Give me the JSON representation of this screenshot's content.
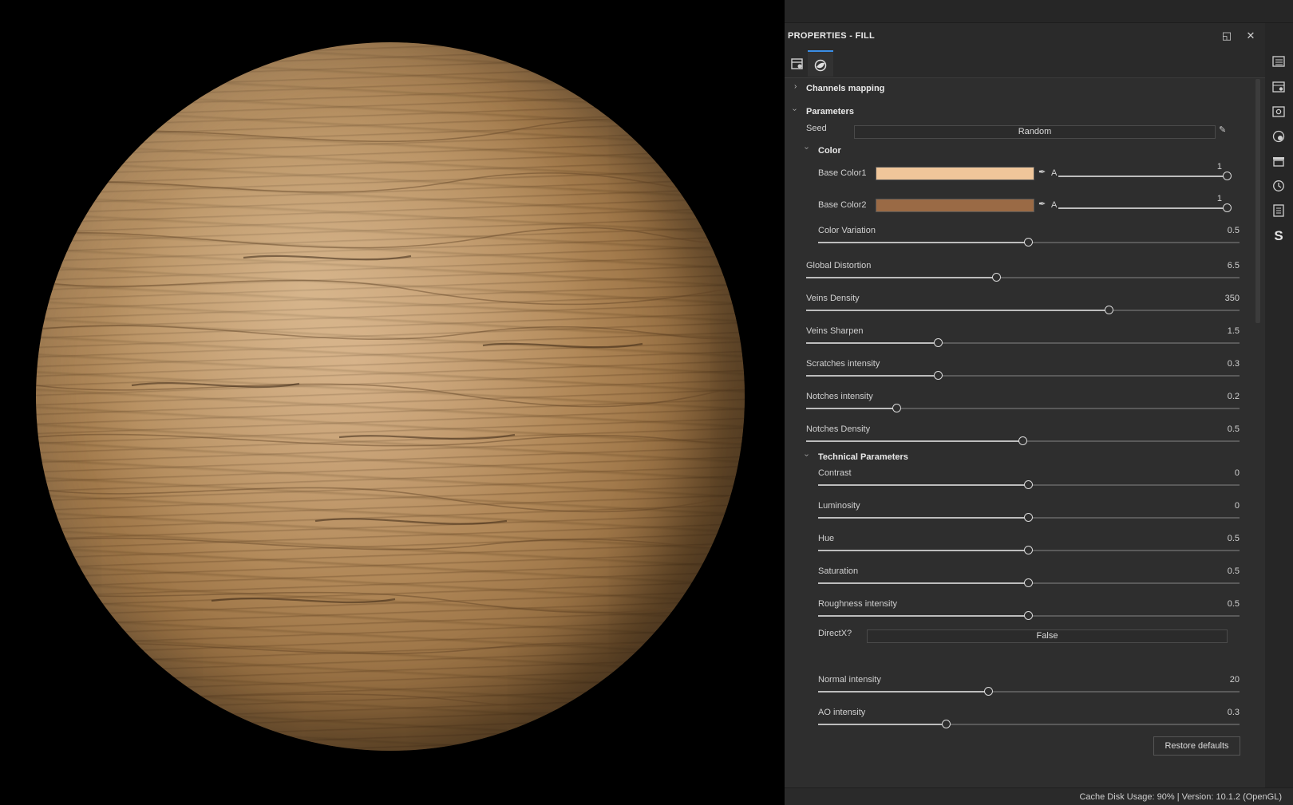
{
  "panel": {
    "title": "PROPERTIES - FILL",
    "restore_label": "◱",
    "close_label": "✕"
  },
  "tabs": [
    {
      "icon": "layer-settings-icon",
      "active": false
    },
    {
      "icon": "material-sphere-icon",
      "active": true
    }
  ],
  "sections": {
    "channels_mapping": "Channels mapping",
    "parameters": "Parameters",
    "color": "Color",
    "technical": "Technical Parameters"
  },
  "seed": {
    "label": "Seed",
    "value": "Random"
  },
  "colors": [
    {
      "label": "Base Color1",
      "hex": "#f0c69a",
      "alpha_label": "A",
      "alpha_value": "1",
      "alpha": 1.0
    },
    {
      "label": "Base Color2",
      "hex": "#9a6a45",
      "alpha_label": "A",
      "alpha_value": "1",
      "alpha": 1.0
    }
  ],
  "sliders": [
    {
      "label": "Color Variation",
      "value": "0.5",
      "fraction": 0.5
    },
    {
      "label": "Global Distortion",
      "value": "6.5",
      "fraction": 0.44
    },
    {
      "label": "Veins Density",
      "value": "350",
      "fraction": 0.7
    },
    {
      "label": "Veins Sharpen",
      "value": "1.5",
      "fraction": 0.305
    },
    {
      "label": "Scratches intensity",
      "value": "0.3",
      "fraction": 0.305
    },
    {
      "label": "Notches intensity",
      "value": "0.2",
      "fraction": 0.21
    },
    {
      "label": "Notches Density",
      "value": "0.5",
      "fraction": 0.5
    }
  ],
  "technical_sliders": [
    {
      "label": "Contrast",
      "value": "0",
      "fraction": 0.5
    },
    {
      "label": "Luminosity",
      "value": "0",
      "fraction": 0.5
    },
    {
      "label": "Hue",
      "value": "0.5",
      "fraction": 0.5
    },
    {
      "label": "Saturation",
      "value": "0.5",
      "fraction": 0.5
    },
    {
      "label": "Roughness intensity",
      "value": "0.5",
      "fraction": 0.5
    }
  ],
  "directx": {
    "label": "DirectX?",
    "value": "False"
  },
  "technical_sliders_2": [
    {
      "label": "Normal intensity",
      "value": "20",
      "fraction": 0.405
    },
    {
      "label": "AO intensity",
      "value": "0.3",
      "fraction": 0.305
    }
  ],
  "restore_defaults": "Restore defaults",
  "status": "Cache Disk Usage:    90% | Version: 10.1.2 (OpenGL)",
  "rightbar_icons": [
    "layers-list-icon",
    "layer-properties-icon",
    "display-settings-icon",
    "viewport-settings-icon",
    "shelf-icon",
    "history-icon",
    "log-icon",
    "substance-icon"
  ]
}
